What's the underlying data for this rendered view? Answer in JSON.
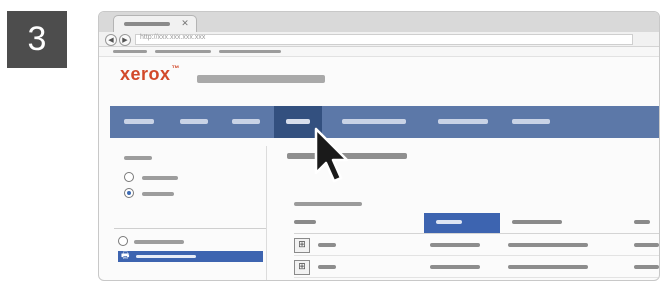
{
  "step": {
    "number": "3"
  },
  "browser": {
    "url": "http://xxx.xxx.xxx.xxx",
    "tab_close_glyph": "✕",
    "back_glyph": "◀",
    "forward_glyph": "▶"
  },
  "header": {
    "logo_text": "xerox",
    "logo_mark": "™"
  },
  "navbar": {
    "items": [
      {
        "name": "nav-item-1"
      },
      {
        "name": "nav-item-2"
      },
      {
        "name": "nav-item-3"
      },
      {
        "name": "nav-item-4",
        "active": true
      },
      {
        "name": "nav-item-5"
      },
      {
        "name": "nav-item-6"
      },
      {
        "name": "nav-item-7"
      }
    ],
    "active_index": 3
  },
  "left_panel": {
    "radio_options": [
      {
        "checked": false
      },
      {
        "checked": true
      }
    ],
    "lower_radio": {
      "checked": false
    },
    "printer_icon": "🖶"
  },
  "table": {
    "row_icon_glyph": "⊞",
    "sorted_column_index": 1,
    "row_count": 2
  },
  "colors": {
    "brand": "#d2492a",
    "navbar": "#5c78a8",
    "navbar_active": "#33507f",
    "selection": "#3d64b0"
  },
  "icons": {
    "cursor": "mouse-pointer-icon",
    "printer": "printer-icon",
    "row_icon": "device-icon"
  }
}
